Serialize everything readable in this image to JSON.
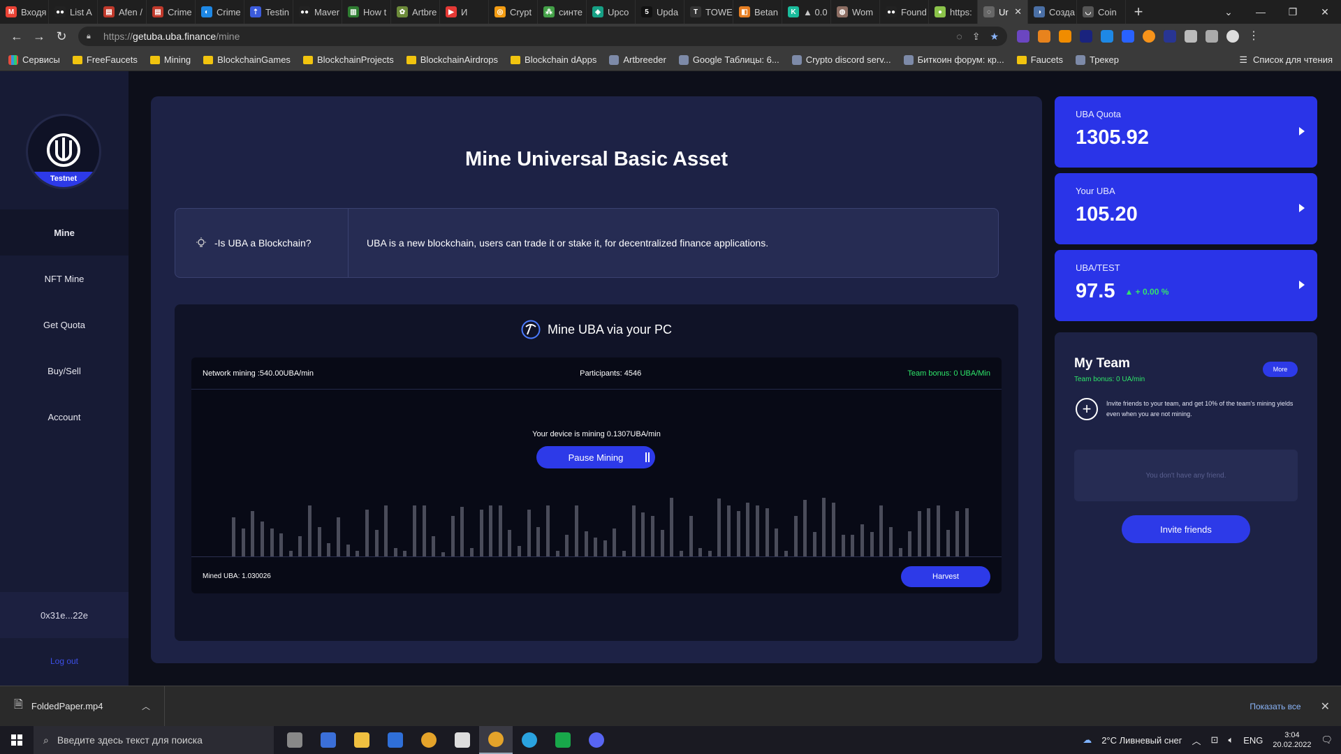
{
  "browser": {
    "tabs": [
      {
        "label": "Входя",
        "color": "#ea4335",
        "glyph": "M"
      },
      {
        "label": "List A",
        "color": "#222222",
        "glyph": "●●"
      },
      {
        "label": "Afen /",
        "color": "#c0392b",
        "glyph": "▤"
      },
      {
        "label": "Crime",
        "color": "#c0392b",
        "glyph": "▤"
      },
      {
        "label": "Crime",
        "color": "#1e88e5",
        "glyph": "◐"
      },
      {
        "label": "Testin",
        "color": "#3b5bdb",
        "glyph": "⇡"
      },
      {
        "label": "Maver",
        "color": "#222222",
        "glyph": "●●"
      },
      {
        "label": "How t",
        "color": "#2f7d32",
        "glyph": "▥"
      },
      {
        "label": "Artbre",
        "color": "#6d8b3a",
        "glyph": "✿"
      },
      {
        "label": "И",
        "color": "#e53935",
        "glyph": "▶"
      },
      {
        "label": "Crypt",
        "color": "#f39c12",
        "glyph": "◎"
      },
      {
        "label": "синте",
        "color": "#43a047",
        "glyph": "⁂"
      },
      {
        "label": "Upco",
        "color": "#16a085",
        "glyph": "◈"
      },
      {
        "label": "Upda",
        "color": "#111111",
        "glyph": "5"
      },
      {
        "label": "TOWE",
        "color": "#333333",
        "glyph": "T"
      },
      {
        "label": "Betan",
        "color": "#e67e22",
        "glyph": "◧"
      },
      {
        "label": "▲ 0.0",
        "color": "#1abc9c",
        "glyph": "K"
      },
      {
        "label": "Wom",
        "color": "#8d6e63",
        "glyph": "◍"
      },
      {
        "label": "Found",
        "color": "#222222",
        "glyph": "●●"
      },
      {
        "label": "https:",
        "color": "#8bc34a",
        "glyph": "●"
      },
      {
        "label": "Ur",
        "color": "#666666",
        "glyph": "◌",
        "active": true
      },
      {
        "label": "Созда",
        "color": "#4a6fa5",
        "glyph": "◑"
      },
      {
        "label": "Coin",
        "color": "#555555",
        "glyph": "◡"
      }
    ],
    "url_scheme": "https://",
    "url_host": "getuba.uba.finance",
    "url_path": "/mine",
    "bookmarks": [
      {
        "label": "Сервисы",
        "kind": "apps"
      },
      {
        "label": "FreeFaucets",
        "kind": "folder"
      },
      {
        "label": "Mining",
        "kind": "folder"
      },
      {
        "label": "BlockchainGames",
        "kind": "folder"
      },
      {
        "label": "BlockchainProjects",
        "kind": "folder"
      },
      {
        "label": "BlockchainAirdrops",
        "kind": "folder"
      },
      {
        "label": "Blockchain dApps",
        "kind": "folder"
      },
      {
        "label": "Artbreeder",
        "kind": "site"
      },
      {
        "label": "Google Таблицы: 6...",
        "kind": "site"
      },
      {
        "label": "Crypto discord serv...",
        "kind": "site"
      },
      {
        "label": "Биткоин форум: кр...",
        "kind": "site"
      },
      {
        "label": "Faucets",
        "kind": "folder"
      },
      {
        "label": "Трекер",
        "kind": "site"
      }
    ],
    "reading_list": "Список для чтения"
  },
  "sidebar": {
    "logo_badge": "Testnet",
    "items": [
      {
        "label": "Mine",
        "active": true
      },
      {
        "label": "NFT Mine"
      },
      {
        "label": "Get Quota"
      },
      {
        "label": "Buy/Sell"
      },
      {
        "label": "Account"
      }
    ],
    "wallet": "0x31e...22e",
    "logout": "Log out"
  },
  "main": {
    "title": "Mine Universal Basic Asset",
    "faq_question": "-Is UBA a Blockchain?",
    "faq_answer": "UBA is a new blockchain, users can trade it or stake it, for decentralized finance applications.",
    "mine_heading": "Mine UBA via your PC",
    "network_mining": "Network mining :540.00UBA/min",
    "participants": "Participants: 4546",
    "team_bonus": "Team bonus: 0 UBA/Min",
    "device_rate": "Your device is mining 0.1307UBA/min",
    "pause_label": "Pause Mining",
    "mined": "Mined UBA: 1.030026",
    "harvest_label": "Harvest",
    "activity_bars": [
      0.58,
      0.42,
      0.68,
      0.52,
      0.42,
      0.34,
      0.08,
      0.3,
      0.76,
      0.44,
      0.2,
      0.58,
      0.18,
      0.08,
      0.7,
      0.4,
      0.76,
      0.12,
      0.08,
      0.76,
      0.76,
      0.3,
      0.06,
      0.6,
      0.74,
      0.12,
      0.7,
      0.76,
      0.76,
      0.4,
      0.16,
      0.7,
      0.44,
      0.76,
      0.08,
      0.32,
      0.76,
      0.38,
      0.28,
      0.24,
      0.42,
      0.08,
      0.76,
      0.66,
      0.6,
      0.4,
      0.88,
      0.08,
      0.6,
      0.12,
      0.08,
      0.86,
      0.76,
      0.68,
      0.8,
      0.76,
      0.72,
      0.42,
      0.08,
      0.6,
      0.84,
      0.36,
      0.88,
      0.8,
      0.32,
      0.32,
      0.48,
      0.36,
      0.76,
      0.44,
      0.12,
      0.38,
      0.68,
      0.72,
      0.76,
      0.4,
      0.68,
      0.72
    ]
  },
  "stats": [
    {
      "label": "UBA Quota",
      "value": "1305.92"
    },
    {
      "label": "Your UBA",
      "value": "105.20"
    },
    {
      "label": "UBA/TEST",
      "value": "97.5",
      "change": "▲ + 0.00 %"
    }
  ],
  "team": {
    "title": "My Team",
    "bonus": "Team bonus: 0 UA/min",
    "more": "More",
    "invite_text": "Invite friends to your team, and get 10% of the team's mining yields even when you are not mining.",
    "empty": "You don't have any friend.",
    "invite_button": "Invite friends"
  },
  "download": {
    "file": "FoldedPaper.mp4",
    "show_all": "Показать все"
  },
  "taskbar": {
    "search_placeholder": "Введите здесь текст для поиска",
    "weather": "2°C  Ливневый снег",
    "lang": "ENG",
    "time": "3:04",
    "date": "20.02.2022",
    "apps": [
      {
        "name": "task-view",
        "color": "#888888"
      },
      {
        "name": "save-app",
        "color": "#3b6fd8"
      },
      {
        "name": "file-explorer",
        "color": "#f0c040"
      },
      {
        "name": "camera-app",
        "color": "#2f6fd8"
      },
      {
        "name": "chrome",
        "color": "#e4a32a"
      },
      {
        "name": "clapper-app",
        "color": "#dddddd"
      },
      {
        "name": "chrome-active",
        "color": "#e4a32a",
        "active": true
      },
      {
        "name": "telegram",
        "color": "#2aa3e0"
      },
      {
        "name": "bolt-app",
        "color": "#18a84a"
      },
      {
        "name": "discord",
        "color": "#5865f2"
      }
    ]
  }
}
